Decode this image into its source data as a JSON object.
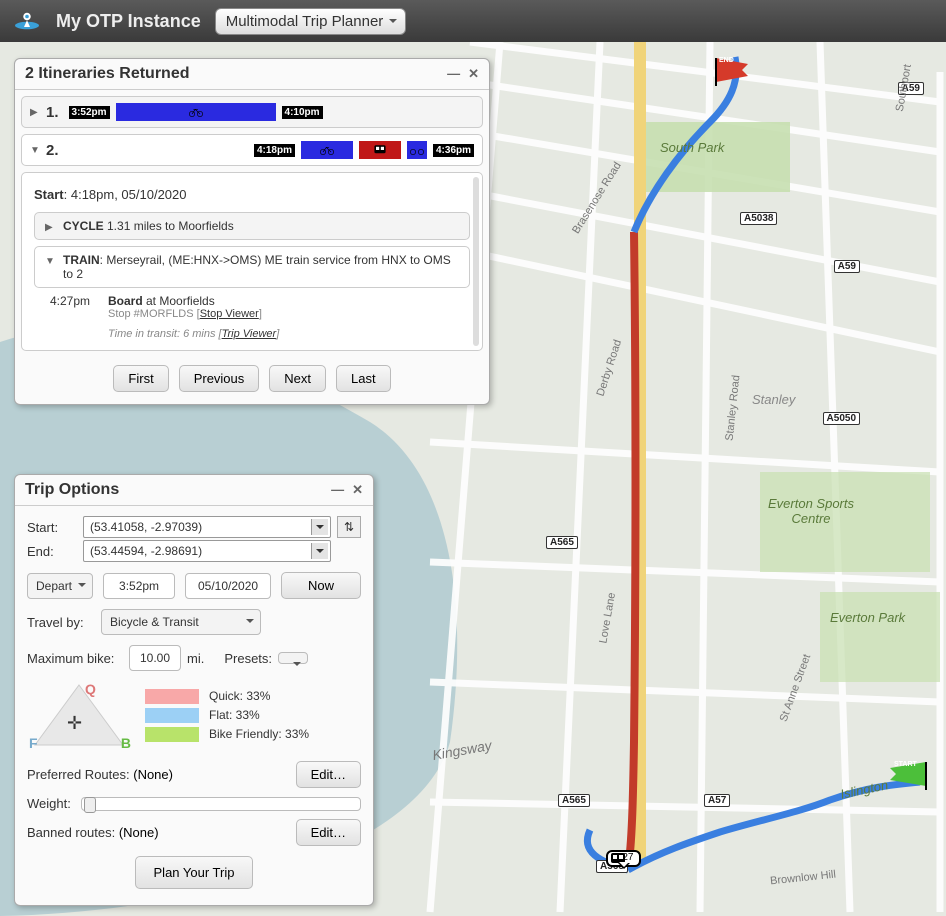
{
  "header": {
    "app_title": "My OTP Instance",
    "mode": "Multimodal Trip Planner"
  },
  "itineraries": {
    "title": "2 Itineraries Returned",
    "row1": {
      "idx": "1.",
      "start": "3:52pm",
      "end": "4:10pm"
    },
    "row2": {
      "idx": "2.",
      "start": "4:18pm",
      "end": "4:36pm"
    },
    "detail": {
      "start_label": "Start",
      "start_value": ": 4:18pm, 05/10/2020",
      "cycle_label": "CYCLE",
      "cycle_text": " 1.31 miles to Moorfields",
      "train_label": "TRAIN",
      "train_text": ": Merseyrail, (ME:HNX->OMS) ME train service from HNX to OMS to 2",
      "board_time": "4:27pm",
      "board_label": "Board",
      "board_text": " at Moorfields",
      "stop_line": "Stop #MORFLDS [",
      "stop_link": "Stop Viewer",
      "transit_line": "Time in transit: 6 mins [",
      "trip_link": "Trip Viewer"
    },
    "nav": {
      "first": "First",
      "prev": "Previous",
      "next": "Next",
      "last": "Last"
    }
  },
  "trip_options": {
    "title": "Trip Options",
    "start_label": "Start:",
    "end_label": "End:",
    "start_value": "(53.41058, -2.97039)",
    "end_value": "(53.44594, -2.98691)",
    "depart": "Depart",
    "time": "3:52pm",
    "date": "05/10/2020",
    "now": "Now",
    "travel_by_label": "Travel by:",
    "travel_by": "Bicycle & Transit",
    "max_bike_label": "Maximum bike:",
    "max_bike": "10.00",
    "mi": "mi.",
    "presets": "Presets:",
    "triangle": {
      "q": "Q",
      "f": "F",
      "b": "B",
      "quick": "Quick: 33%",
      "flat": "Flat: 33%",
      "friendly": "Bike Friendly: 33%",
      "quick_color": "#f8a8a8",
      "flat_color": "#9cd0f5",
      "friendly_color": "#b8e36a"
    },
    "preferred_label": "Preferred Routes:",
    "preferred_val": "(None)",
    "banned_label": "Banned routes:",
    "banned_val": "(None)",
    "weight_label": "Weight:",
    "edit": "Edit…",
    "plan": "Plan Your Trip"
  },
  "map": {
    "roads": {
      "a59a": "A59",
      "a59b": "A59",
      "a5038": "A5038",
      "a5050": "A5050",
      "a565a": "A565",
      "a565b": "A565",
      "a565c": "A565",
      "a57": "A57"
    },
    "parks": {
      "south": "South Park",
      "everton_sports": "Everton Sports\nCentre",
      "everton_park": "Everton Park",
      "stanley": "Stanley",
      "islington": "Islington"
    },
    "streets": {
      "brasenose": "Brasenose Road",
      "derby": "Derby Road",
      "love": "Love Lane",
      "kingsway": "Kingsway",
      "stanley_rd": "Stanley Road",
      "anne": "St Anne Street",
      "brownlow": "Brownlow Hill",
      "southport": "Southport"
    },
    "station": {
      "time": "4:27"
    },
    "flags": {
      "start": "START",
      "end": "END"
    }
  }
}
